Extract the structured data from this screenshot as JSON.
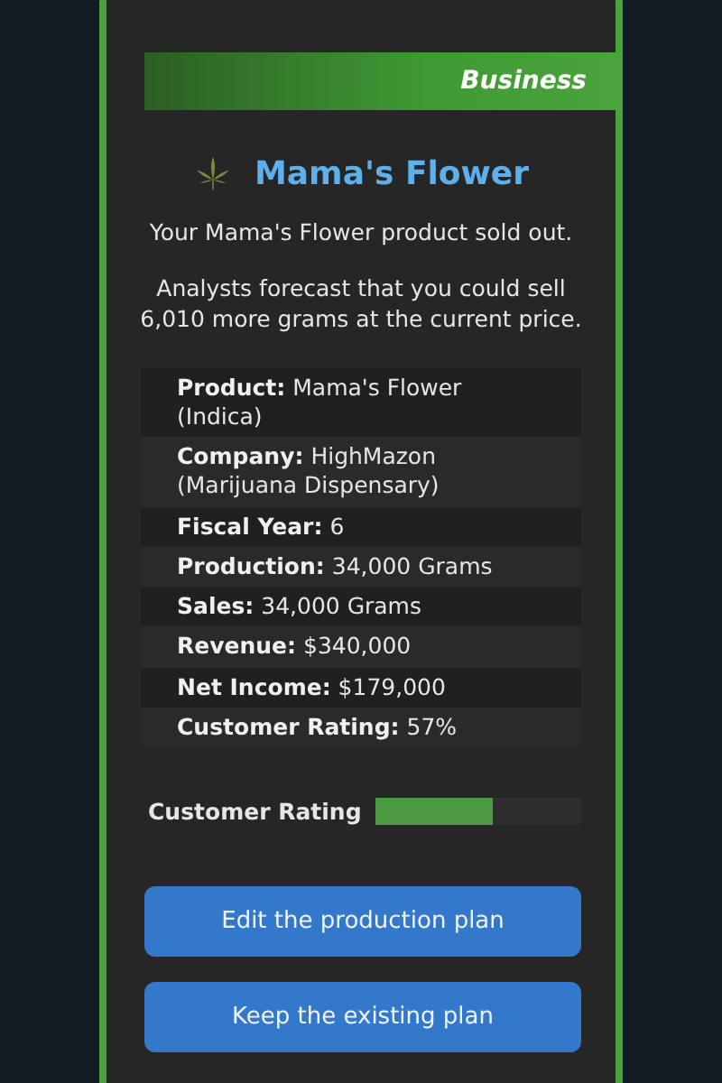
{
  "dialog": {
    "category": "Business",
    "title": "Mama's Flower",
    "message": "Your Mama's Flower product sold out.",
    "forecast": "Analysts forecast that you could sell 6,010 more grams at the current price.",
    "details": [
      {
        "label": "Product:",
        "value": "Mama's Flower (Indica)"
      },
      {
        "label": "Company:",
        "value": "HighMazon (Marijuana Dispensary)"
      },
      {
        "label": "Fiscal Year:",
        "value": "6"
      },
      {
        "label": "Production:",
        "value": "34,000 Grams"
      },
      {
        "label": "Sales:",
        "value": "34,000 Grams"
      },
      {
        "label": "Revenue:",
        "value": "$340,000"
      },
      {
        "label": "Net Income:",
        "value": "$179,000"
      },
      {
        "label": "Customer Rating:",
        "value": "57%"
      }
    ],
    "meter": {
      "label": "Customer Rating",
      "level": 0.57
    },
    "buttons": [
      "Edit the production plan",
      "Keep the existing plan"
    ]
  }
}
